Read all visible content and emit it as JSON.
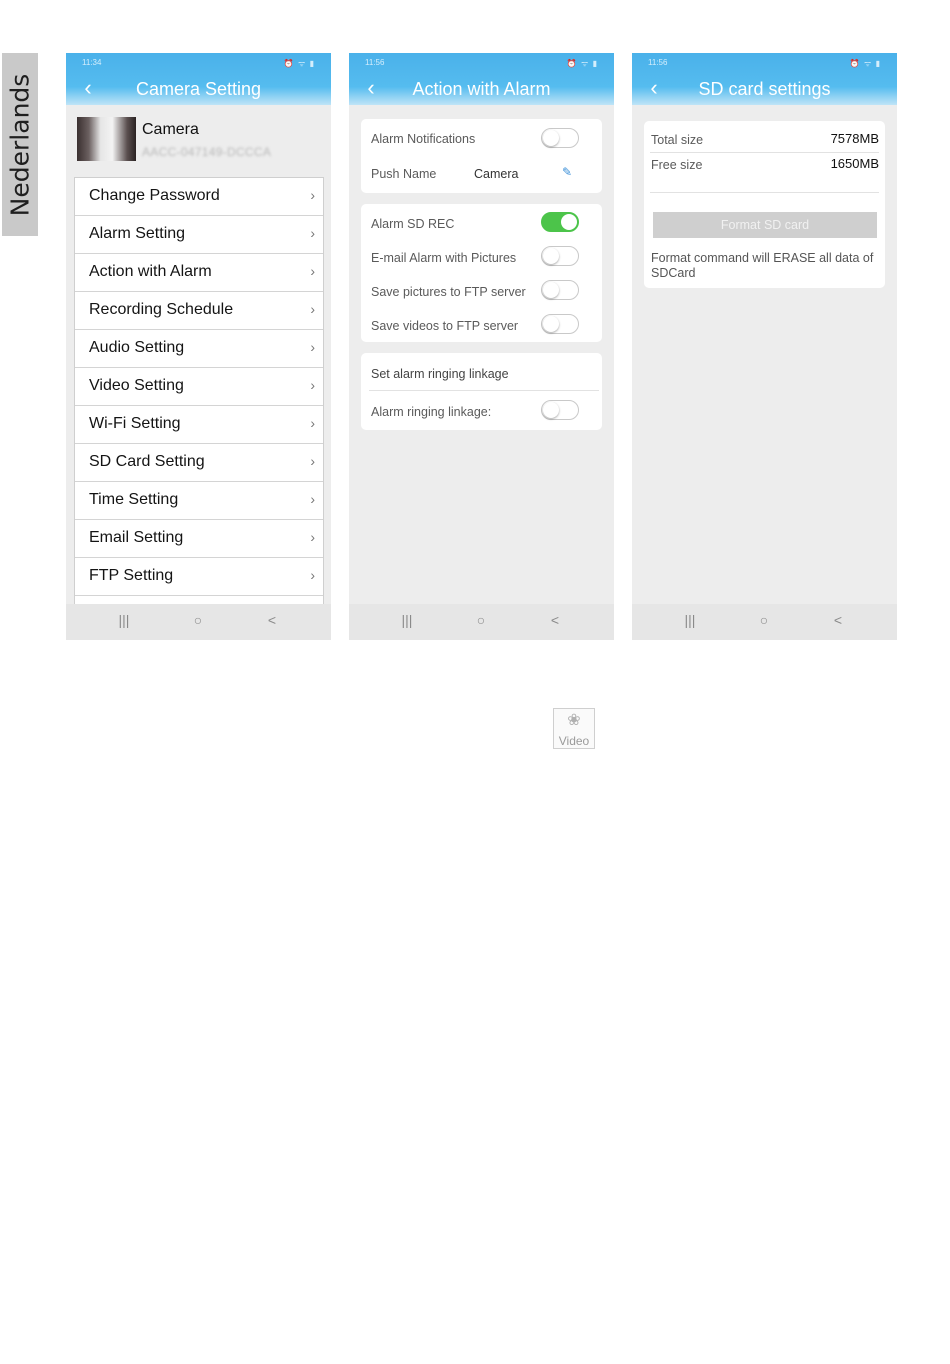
{
  "side_tab": {
    "label": "Nederlands"
  },
  "colors": {
    "header_blue": "#4ab1ea",
    "toggle_on": "#4cc44a",
    "background": "#ededed"
  },
  "nav_icons": {
    "recent": "|||",
    "home": "○",
    "back": "<"
  },
  "phone1": {
    "status_time": "11:34",
    "title": "Camera Setting",
    "camera": {
      "name": "Camera",
      "uid": "AACC-047149-DCCCA"
    },
    "menu": [
      "Change Password",
      "Alarm Setting",
      "Action with Alarm",
      "Recording Schedule",
      "Audio Setting",
      "Video Setting",
      "Wi-Fi Setting",
      "SD Card Setting",
      "Time Setting",
      "Email Setting",
      "FTP Setting"
    ]
  },
  "phone2": {
    "status_time": "11:56",
    "title": "Action with Alarm",
    "alarm_notifications": {
      "label": "Alarm Notifications",
      "on": false
    },
    "push_name": {
      "label": "Push Name",
      "value": "Camera"
    },
    "alarm_sd_rec": {
      "label": "Alarm SD REC",
      "on": true
    },
    "email_alarm": {
      "label": "E-mail Alarm with Pictures",
      "on": false
    },
    "ftp_pictures": {
      "label": "Save pictures to FTP server",
      "on": false
    },
    "ftp_videos": {
      "label": "Save videos to FTP server",
      "on": false
    },
    "ringing_header": "Set alarm ringing linkage",
    "ringing_linkage": {
      "label": "Alarm ringing linkage:",
      "on": false
    }
  },
  "phone3": {
    "status_time": "11:56",
    "title": "SD card settings",
    "total": {
      "label": "Total size",
      "value": "7578MB"
    },
    "free": {
      "label": "Free size",
      "value": "1650MB"
    },
    "format_button": "Format SD card",
    "format_note": "Format command will ERASE all data of SDCard"
  },
  "video_icon": {
    "label": "Video"
  }
}
